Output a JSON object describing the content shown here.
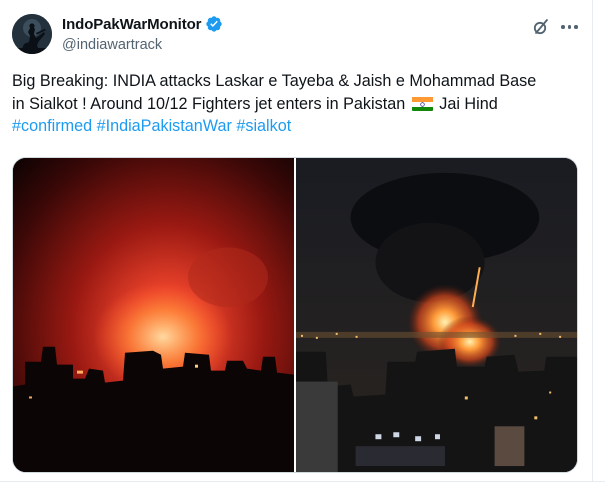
{
  "author": {
    "display_name": "IndoPakWarMonitor",
    "handle": "@indiawartrack",
    "verified": true,
    "avatar_icon": "soldier-silhouette-avatar"
  },
  "header_actions": {
    "grok_icon": "grok-icon",
    "more_icon": "more-dots-icon"
  },
  "tweet": {
    "line1": "Big Breaking: INDIA attacks Laskar e Tayeba & Jaish e Mohammad Base",
    "line2_before_flag": "in Sialkot ! Around 10/12 Fighters jet enters in Pakistan",
    "line2_after_flag": "Jai Hind",
    "hashtags": [
      "#confirmed",
      "#IndiaPakistanWar",
      "#sialkot"
    ],
    "flag_icon": "india-flag-icon"
  },
  "media": {
    "left_image": "night-explosion-red-glow-image",
    "right_image": "night-explosion-city-smoke-image"
  },
  "colors": {
    "text": "#0f1419",
    "muted": "#536471",
    "link": "#1d9bf0",
    "verified": "#1d9bf0",
    "border": "#cfd9de"
  }
}
